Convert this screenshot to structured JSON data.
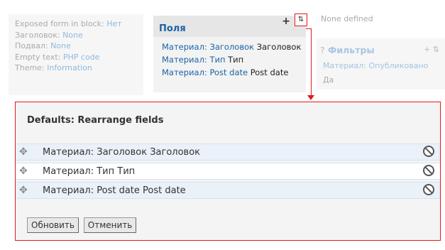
{
  "left_panel": {
    "exposed_label": "Exposed form in block:",
    "exposed_value": "Нет",
    "header_label": "Заголовок:",
    "header_value": "None",
    "footer_label": "Подвал:",
    "footer_value": "None",
    "empty_label": "Empty text:",
    "empty_value": "PHP code",
    "theme_label": "Theme:",
    "theme_value": "Information"
  },
  "fields": {
    "title": "Поля",
    "plus_icon": "+",
    "rearrange_icon": "⇅",
    "items": [
      {
        "link": "Материал: Заголовок",
        "label": "Заголовок"
      },
      {
        "link": "Материал: Тип",
        "label": "Тип"
      },
      {
        "link": "Материал: Post date",
        "label": "Post date"
      }
    ]
  },
  "right_top": {
    "text": "None defined"
  },
  "filters": {
    "help_icon": "?",
    "title": "Фильтры",
    "icons": "+ ⇅",
    "item_link": "Материал: Опубликовано",
    "item_value": "Да"
  },
  "dialog": {
    "title": "Defaults: Rearrange fields",
    "rows": [
      {
        "label": "Материал: Заголовок Заголовок"
      },
      {
        "label": "Материал: Тип Тип"
      },
      {
        "label": "Материал: Post date Post date"
      }
    ],
    "update_button": "Обновить",
    "cancel_button": "Отменить"
  },
  "colors": {
    "accent": "#1c63a6",
    "highlight_border": "#e21b1b",
    "row_alt": "#eaf1f8"
  }
}
